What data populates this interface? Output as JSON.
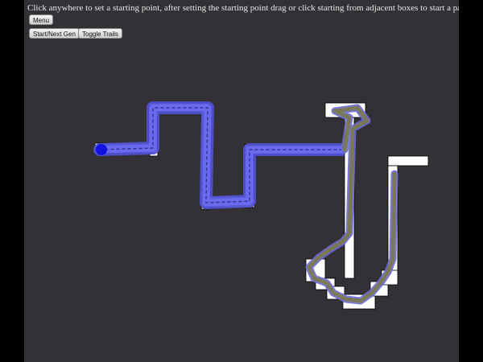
{
  "instructions": "Click anywhere to set a starting point, after setting the starting point drag or click starting from adjacent boxes to start a path",
  "buttons": {
    "menu": "Menu",
    "start_next_gen": "Start/Next Gen",
    "toggle_trails": "Toggle Trails"
  },
  "colors": {
    "stage_background": "#333135",
    "outer_background": "#000000",
    "path_cell": "#ffffff",
    "trail_blue": "#5a5ae0",
    "trail_olive": "#7a7a52",
    "start_point": "#1010e0"
  }
}
